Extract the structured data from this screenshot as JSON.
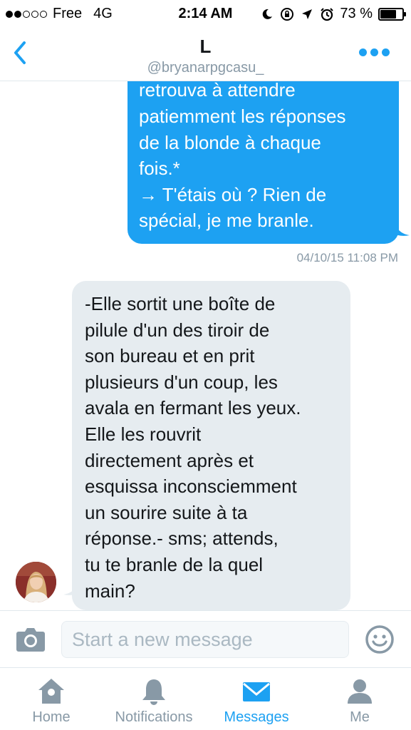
{
  "status_bar": {
    "carrier": "Free",
    "network": "4G",
    "time": "2:14 AM",
    "battery": "73 %",
    "battery_level": 0.73,
    "signal_bars": 2,
    "signal_total": 5,
    "icons": [
      "moon-icon",
      "rotation-lock-icon",
      "location-icon",
      "alarm-icon"
    ]
  },
  "header": {
    "title": "L",
    "handle": "@bryanarpgcasu_",
    "back_icon": "chevron-left-icon",
    "more_icon": "more-dots-icon"
  },
  "conversation": {
    "outgoing": {
      "text": "retrouva à attendre\npatiemment les réponses\nde la blonde à chaque\nfois.*\n→ T'étais où ? Rien de\nspécial, je me branle.",
      "timestamp": "04/10/15 11:08 PM"
    },
    "incoming": {
      "text": "-Elle sortit une boîte de\npilule d'un des tiroir de\nson bureau et en prit\nplusieurs d'un coup, les\navala en fermant les yeux.\nElle les rouvrit\ndirectement après et\nesquissa inconsciemment\nun sourire suite à ta\nréponse.- sms; attends,\ntu te branle de la quel\nmain?"
    }
  },
  "composer": {
    "placeholder": "Start a new message",
    "camera_icon": "camera-icon",
    "emoji_icon": "smiley-icon"
  },
  "tabbar": {
    "home": "Home",
    "notifications": "Notifications",
    "messages": "Messages",
    "me": "Me",
    "active": "messages"
  },
  "colors": {
    "accent": "#1da1f2",
    "incoming_bubble": "#e6ecf0",
    "muted": "#8899a6"
  }
}
